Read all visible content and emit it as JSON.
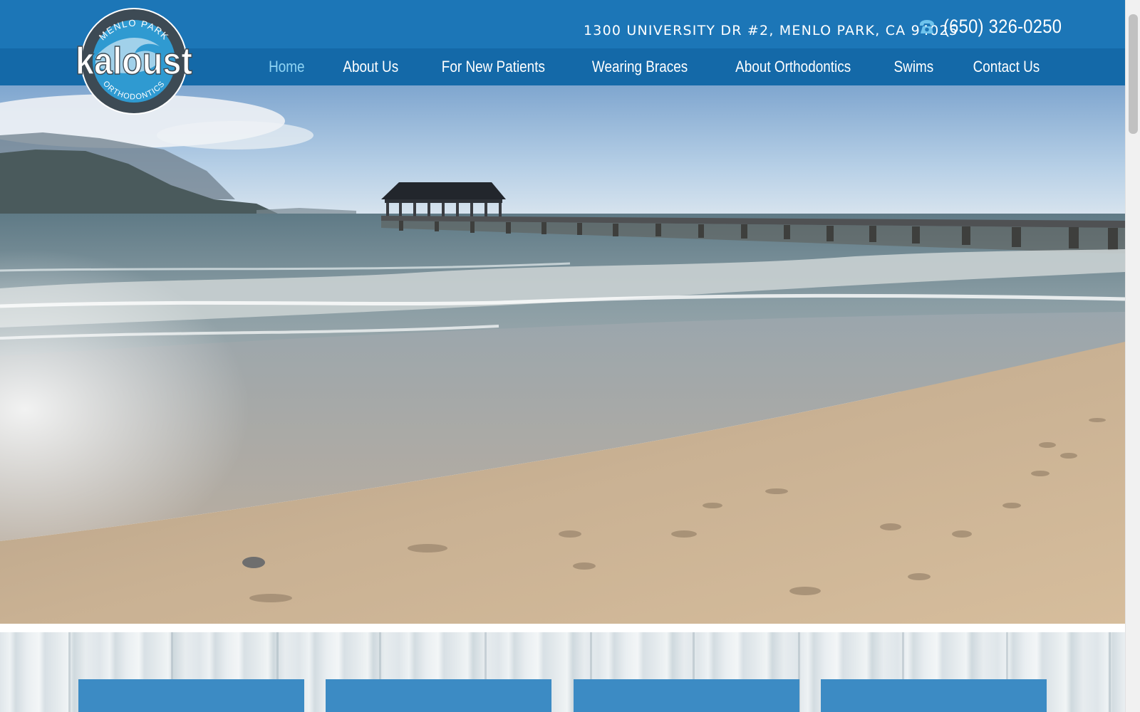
{
  "header": {
    "address": "1300 UNIVERSITY DR #2, MENLO PARK, CA 94025",
    "phone": "(650) 326-0250",
    "phone_icon": "phone-icon"
  },
  "logo": {
    "top_text": "MENLO PARK",
    "main_text": "kaloust",
    "bottom_text": "ORTHODONTICS"
  },
  "nav": {
    "items": [
      {
        "label": "Home",
        "active": true
      },
      {
        "label": "About Us",
        "active": false
      },
      {
        "label": "For New Patients",
        "active": false
      },
      {
        "label": "Wearing Braces",
        "active": false
      },
      {
        "label": "About Orthodontics",
        "active": false
      },
      {
        "label": "Swims",
        "active": false
      },
      {
        "label": "Contact Us",
        "active": false
      }
    ]
  },
  "colors": {
    "header_blue": "#1c76b7",
    "nav_blue": "#1469a8",
    "active_link": "#8fd4f4",
    "feature_box_blue": "#3c8bc4",
    "logo_circle_dark": "#3d4a54",
    "logo_circle_blue": "#2f9ad1"
  }
}
